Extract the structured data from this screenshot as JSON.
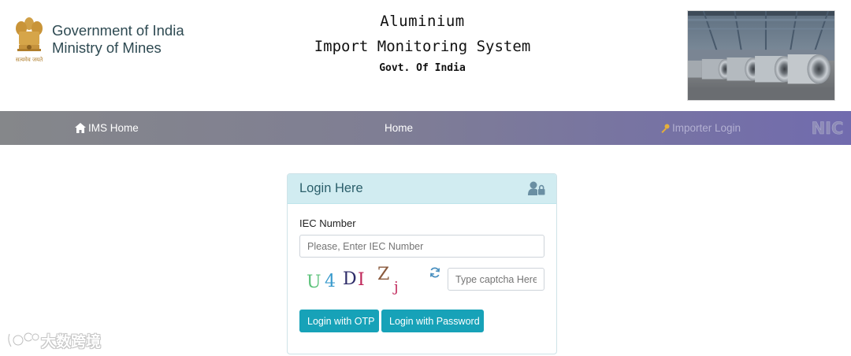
{
  "header": {
    "emblem_motto": "सत्यमेव जयते",
    "gov_line1": "Government of India",
    "gov_line2": "Ministry of Mines",
    "title_line1": "Aluminium",
    "title_line2": "Import Monitoring System",
    "title_line3": "Govt. Of India"
  },
  "navbar": {
    "ims_home": "IMS Home",
    "home": "Home",
    "importer_login": "Importer Login",
    "nic_logo_text": "NIC"
  },
  "login": {
    "title": "Login Here",
    "iec_label": "IEC Number",
    "iec_value": "",
    "iec_placeholder": "Please, Enter IEC Number",
    "captcha_chars": [
      "U",
      "4",
      "D",
      "I",
      "Z",
      "j"
    ],
    "captcha_value": "",
    "captcha_placeholder": "Type captcha Here",
    "otp_button": "Login with OTP",
    "password_button": "Login with Password"
  },
  "watermark": {
    "text": "大数跨境"
  },
  "colors": {
    "primary_button": "#17a2b8",
    "card_header_bg": "#d1ecf1",
    "card_title": "#2b5f6b",
    "navbar_start": "#85878a",
    "navbar_end": "#716bae"
  },
  "icons": {
    "emblem": "national-emblem-icon",
    "home": "home-icon",
    "key": "key-icon",
    "user_lock": "user-lock-icon",
    "refresh": "refresh-icon"
  }
}
